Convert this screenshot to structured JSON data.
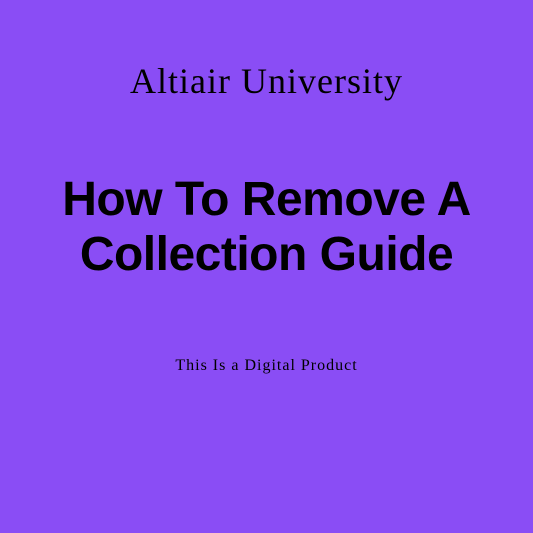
{
  "brand": "Altiair University",
  "title": "How To Remove A Collection Guide",
  "subtitle": "This Is a Digital Product"
}
